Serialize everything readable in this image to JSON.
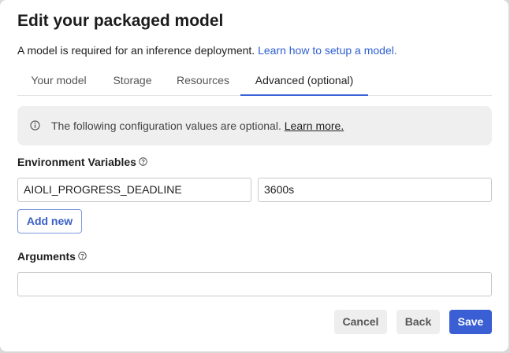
{
  "dialog": {
    "title": "Edit your packaged model",
    "subtitle_text": "A model is required for an inference deployment.",
    "subtitle_link": "Learn how to setup a model."
  },
  "tabs": [
    {
      "label": "Your model",
      "active": false
    },
    {
      "label": "Storage",
      "active": false
    },
    {
      "label": "Resources",
      "active": false
    },
    {
      "label": "Advanced (optional)",
      "active": true
    }
  ],
  "notice": {
    "icon": "info-icon",
    "text": "The following configuration values are optional.",
    "link": "Learn more."
  },
  "env_vars": {
    "label": "Environment Variables",
    "help_icon": "help-icon",
    "rows": [
      {
        "name": "AIOLI_PROGRESS_DEADLINE",
        "value": "3600s"
      }
    ],
    "add_button": "Add new"
  },
  "arguments": {
    "label": "Arguments",
    "help_icon": "help-icon",
    "value": ""
  },
  "footer": {
    "cancel": "Cancel",
    "back": "Back",
    "save": "Save"
  },
  "colors": {
    "primary": "#3a5fd4",
    "link": "#2f5fd0",
    "tab_active_underline": "#3b63d6",
    "notice_bg": "#efefef"
  }
}
